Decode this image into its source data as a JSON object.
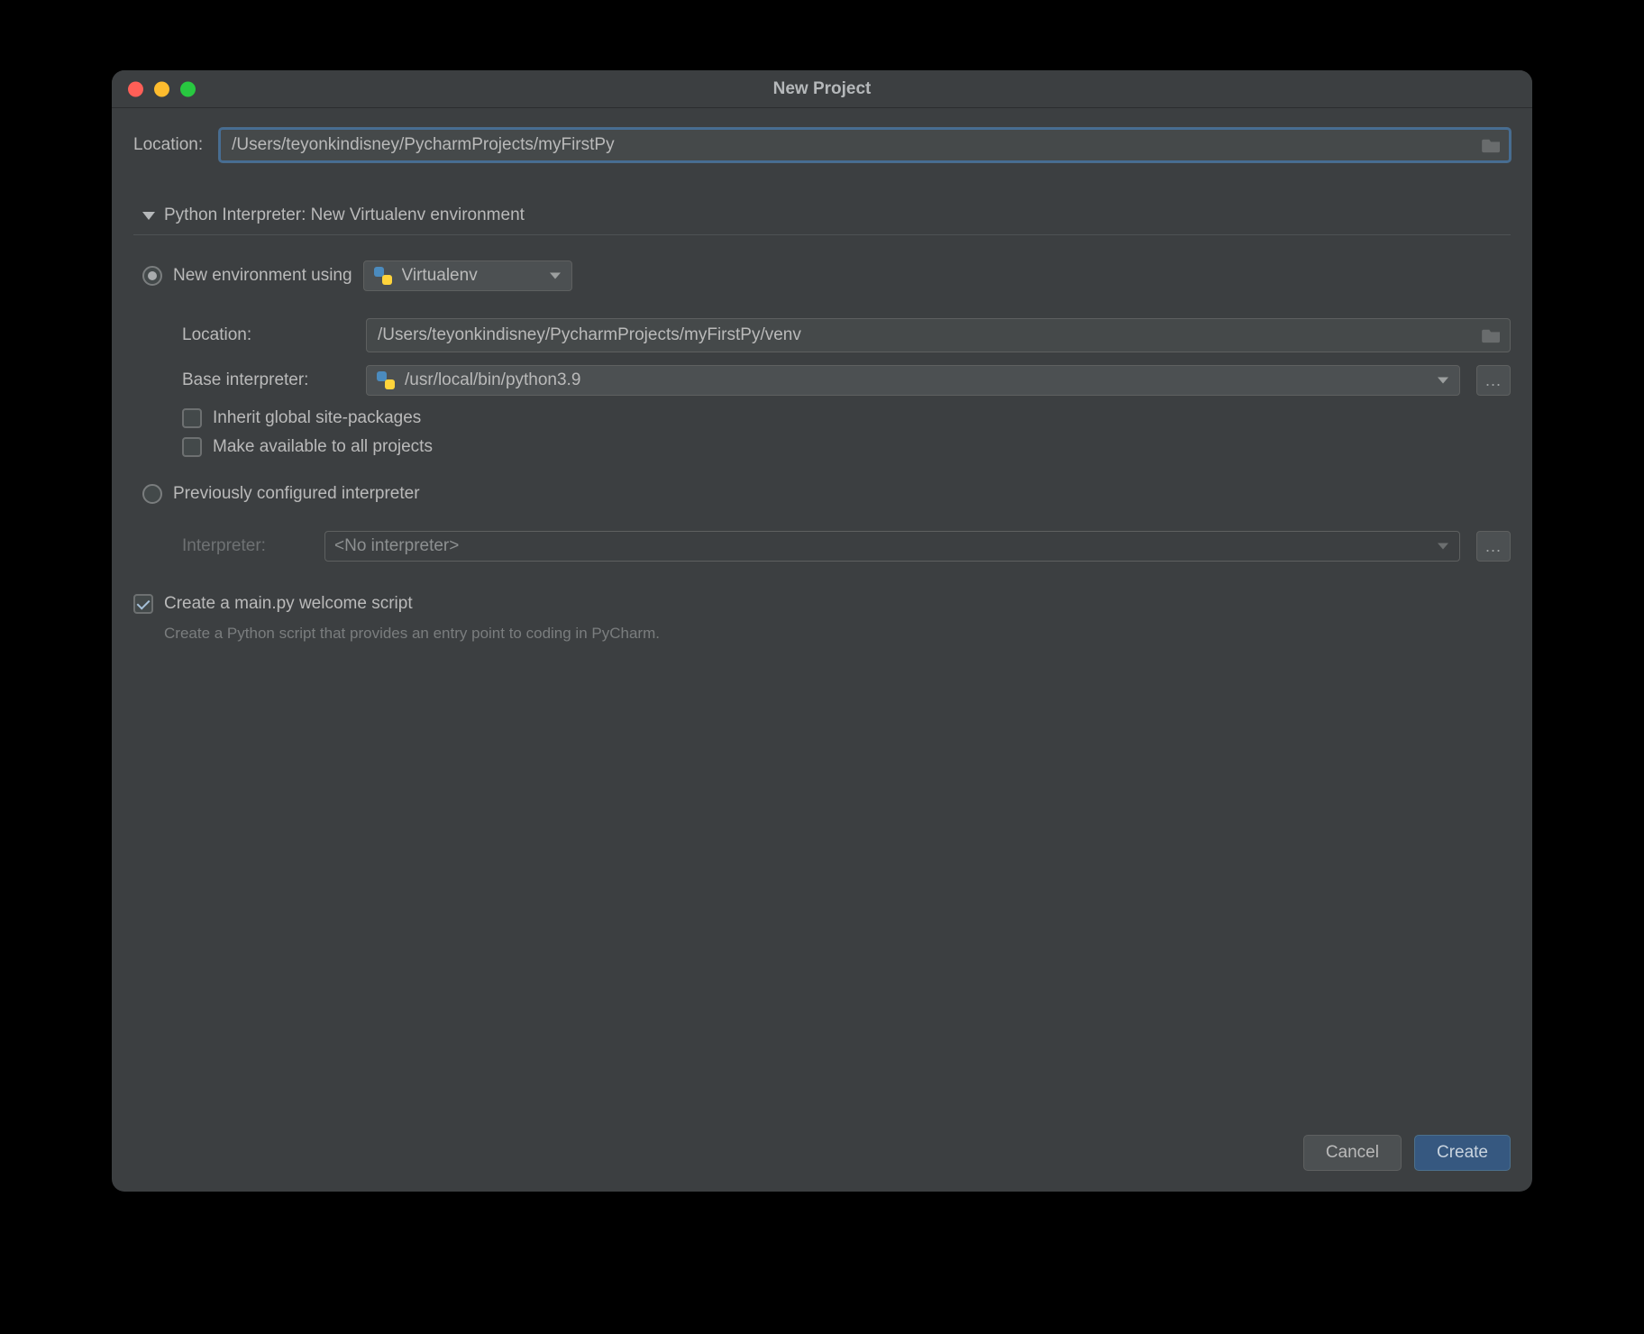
{
  "window": {
    "title": "New Project"
  },
  "location": {
    "label": "Location:",
    "value": "/Users/teyonkindisney/PycharmProjects/myFirstPy"
  },
  "interpreter_section": {
    "title": "Python Interpreter: New Virtualenv environment"
  },
  "new_env": {
    "radio_label": "New environment using",
    "tool": "Virtualenv",
    "location_label": "Location:",
    "location_value": "/Users/teyonkindisney/PycharmProjects/myFirstPy/venv",
    "base_label": "Base interpreter:",
    "base_value": "/usr/local/bin/python3.9",
    "inherit_label": "Inherit global site-packages",
    "make_available_label": "Make available to all projects"
  },
  "prev_env": {
    "radio_label": "Previously configured interpreter",
    "interp_label": "Interpreter:",
    "interp_value": "<No interpreter>"
  },
  "welcome": {
    "label": "Create a main.py welcome script",
    "hint": "Create a Python script that provides an entry point to coding in PyCharm."
  },
  "buttons": {
    "cancel": "Cancel",
    "create": "Create"
  },
  "glyphs": {
    "ellipsis": "..."
  }
}
